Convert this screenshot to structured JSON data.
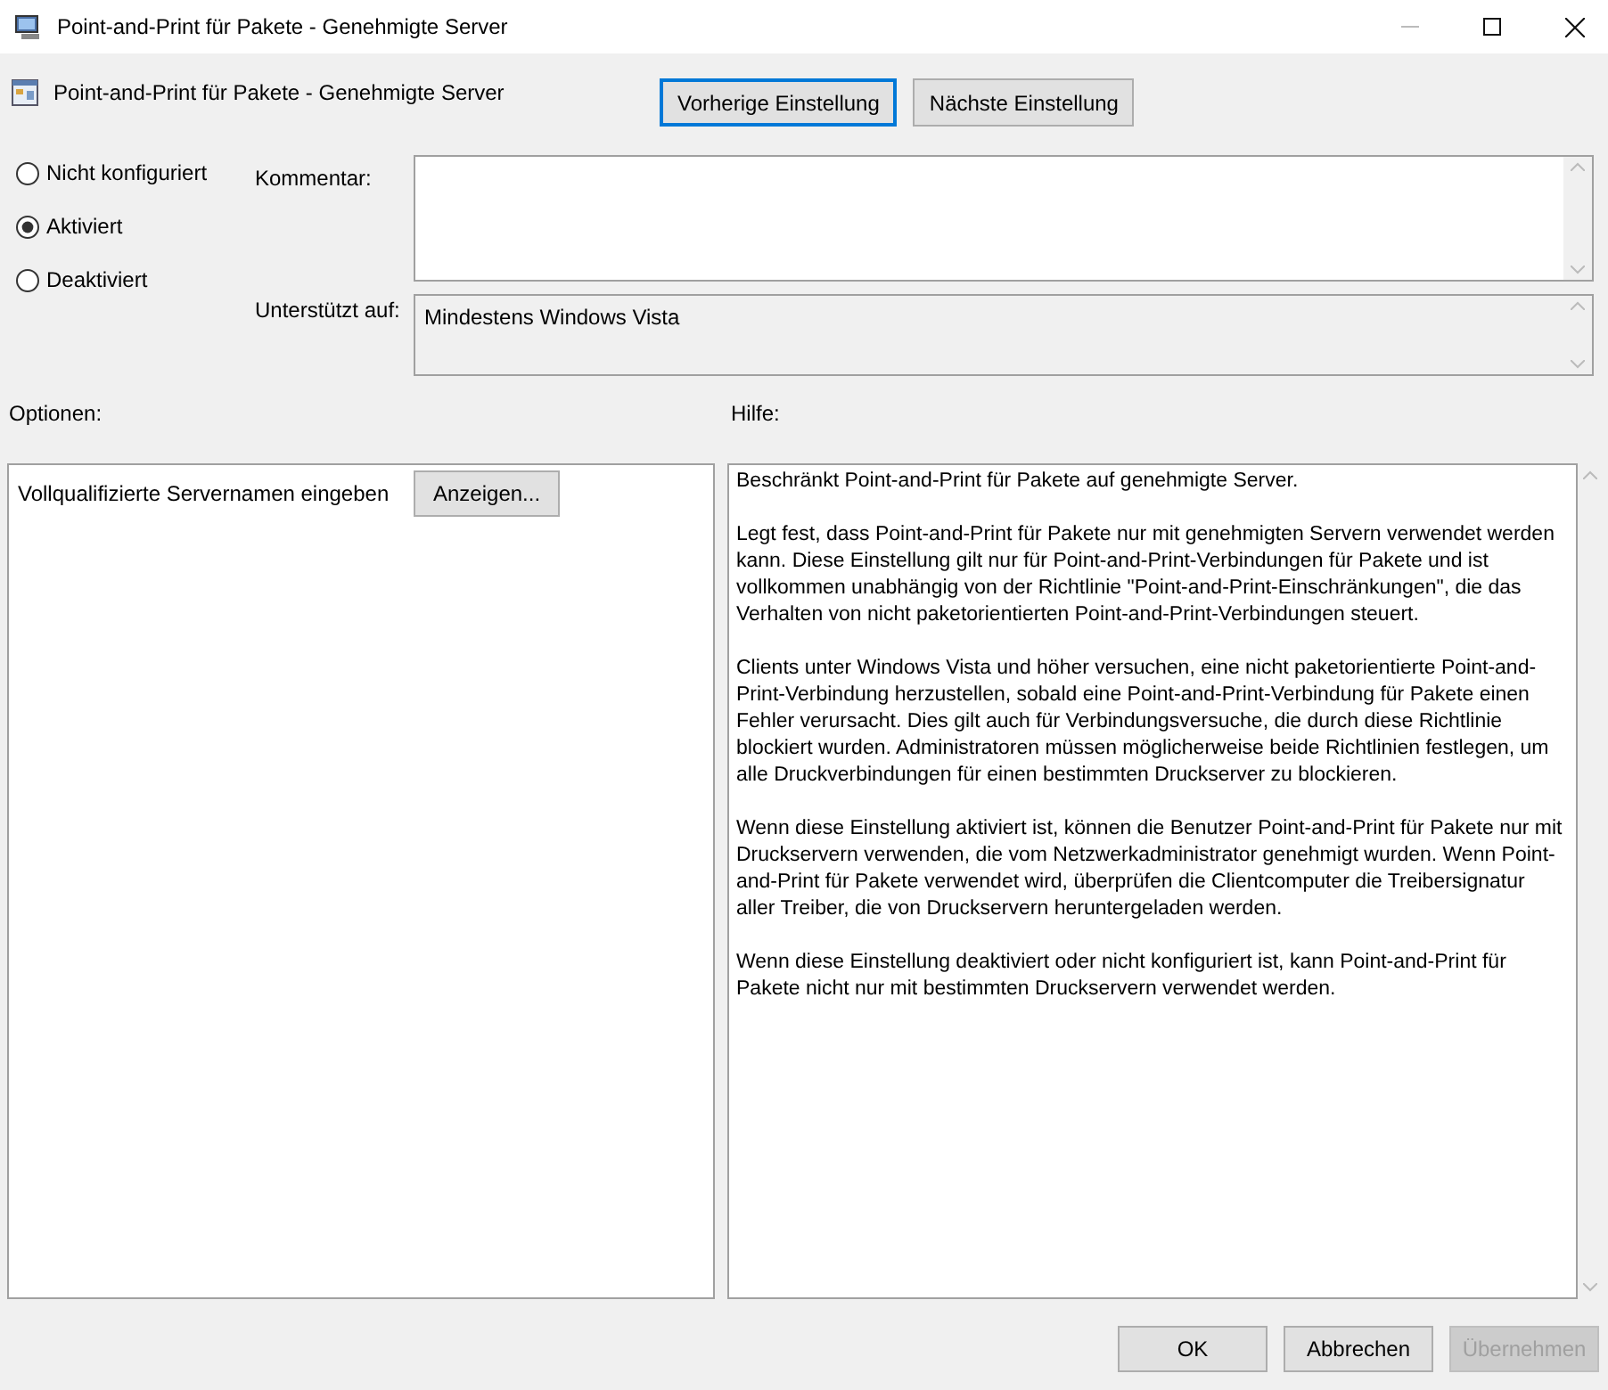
{
  "window": {
    "title": "Point-and-Print für Pakete - Genehmigte Server"
  },
  "header": {
    "title": "Point-and-Print für Pakete - Genehmigte Server"
  },
  "nav_buttons": [
    {
      "label": "Vorherige Einstellung",
      "focused": true
    },
    {
      "label": "Nächste Einstellung",
      "focused": false
    }
  ],
  "state_options": [
    {
      "label": "Nicht konfiguriert",
      "selected": false
    },
    {
      "label": "Aktiviert",
      "selected": true
    },
    {
      "label": "Deaktiviert",
      "selected": false
    }
  ],
  "comment": {
    "label": "Kommentar:"
  },
  "supported": {
    "label": "Unterstützt auf:",
    "value": "Mindestens Windows Vista"
  },
  "options": {
    "label": "Optionen:",
    "items": [
      {
        "label": "Vollqualifizierte Servernamen eingeben",
        "button": "Anzeigen..."
      }
    ]
  },
  "help": {
    "label": "Hilfe:",
    "paragraphs": [
      "Beschränkt Point-and-Print für Pakete auf genehmigte Server.",
      "Legt fest, dass Point-and-Print für Pakete nur mit genehmigten Servern verwendet werden kann. Diese Einstellung gilt nur für Point-and-Print-Verbindungen für Pakete und ist vollkommen unabhängig von der Richtlinie \"Point-and-Print-Einschränkungen\", die das Verhalten von nicht paketorientierten Point-and-Print-Verbindungen steuert.",
      "Clients unter Windows Vista und höher versuchen, eine nicht paketorientierte Point-and-Print-Verbindung herzustellen, sobald eine Point-and-Print-Verbindung für Pakete einen Fehler verursacht. Dies gilt auch für Verbindungsversuche, die durch diese Richtlinie blockiert wurden. Administratoren müssen möglicherweise beide Richtlinien festlegen, um alle Druckverbindungen für einen bestimmten Druckserver zu blockieren.",
      "Wenn diese Einstellung aktiviert ist, können die Benutzer Point-and-Print für Pakete nur mit Druckservern verwenden, die vom Netzwerkadministrator genehmigt wurden. Wenn Point-and-Print für Pakete verwendet wird, überprüfen die Clientcomputer die Treibersignatur aller Treiber, die von Druckservern heruntergeladen werden.",
      "Wenn diese Einstellung deaktiviert oder nicht konfiguriert ist, kann Point-and-Print für Pakete nicht nur mit bestimmten Druckservern verwendet werden."
    ]
  },
  "buttons": [
    {
      "label": "OK",
      "disabled": false
    },
    {
      "label": "Abbrechen",
      "disabled": false
    },
    {
      "label": "Übernehmen",
      "disabled": true
    }
  ]
}
